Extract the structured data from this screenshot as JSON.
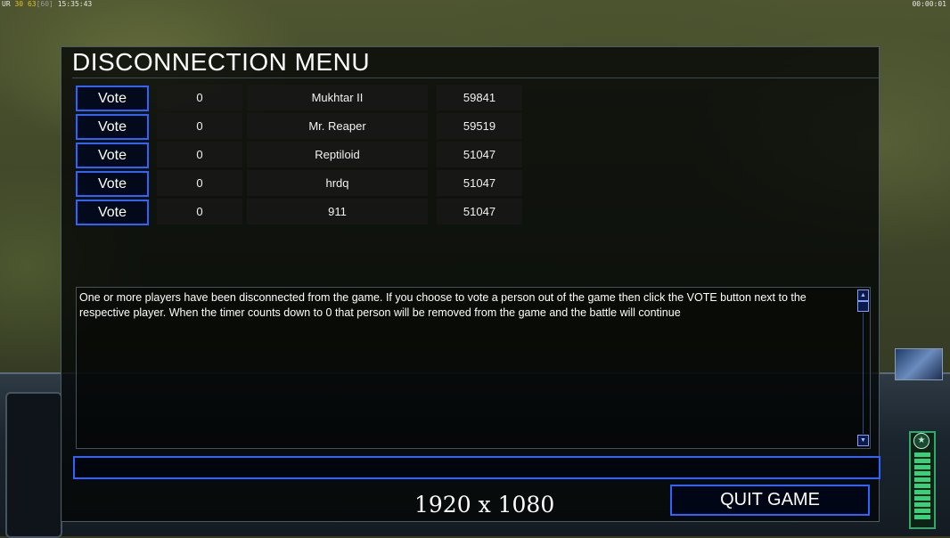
{
  "hud": {
    "left_prefix": "UR",
    "left_value_1": "30",
    "left_value_2": "63",
    "left_value_3": "60",
    "clock": "15:35:43",
    "elapsed": "00:00:01"
  },
  "dialog": {
    "title": "DISCONNECTION MENU",
    "players": [
      {
        "vote_label": "Vote",
        "timer": "0",
        "name": "Mukhtar II",
        "ping": "59841"
      },
      {
        "vote_label": "Vote",
        "timer": "0",
        "name": "Mr. Reaper",
        "ping": "59519"
      },
      {
        "vote_label": "Vote",
        "timer": "0",
        "name": "Reptiloid",
        "ping": "51047"
      },
      {
        "vote_label": "Vote",
        "timer": "0",
        "name": "hrdq",
        "ping": "51047"
      },
      {
        "vote_label": "Vote",
        "timer": "0",
        "name": "911",
        "ping": "51047"
      }
    ],
    "message": "One or more players have been disconnected from the game. If you choose to vote a person out of the game then click the VOTE button next to the respective player. When the timer counts down to 0 that person will be removed from the game and the battle will continue",
    "chat_value": "",
    "resolution": "1920 x 1080",
    "quit_label": "QUIT GAME"
  },
  "colors": {
    "accent_border": "#2d63ff",
    "power_meter": "#39d07a"
  }
}
